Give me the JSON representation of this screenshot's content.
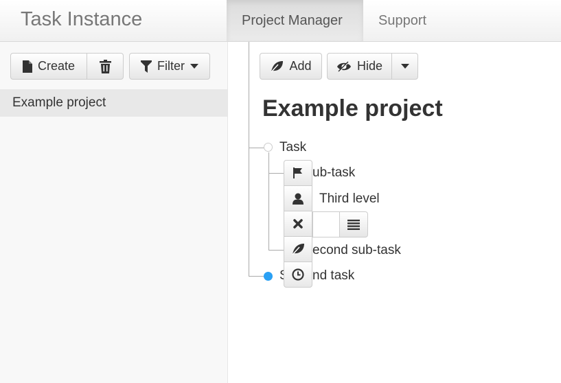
{
  "navbar": {
    "brand": "Task Instance",
    "tabs": [
      {
        "label": "Project Manager",
        "active": true
      },
      {
        "label": "Support",
        "active": false
      }
    ]
  },
  "sidebar": {
    "create_label": "Create",
    "filter_label": "Filter",
    "projects": [
      {
        "label": "Example project",
        "selected": true
      }
    ]
  },
  "main": {
    "add_label": "Add",
    "hide_label": "Hide",
    "title": "Example project",
    "tree": [
      {
        "label": "Task",
        "complete": false,
        "visible_text": "Task"
      },
      {
        "label": "Sub-task",
        "visible_text": "ub-task"
      },
      {
        "label": "Third level",
        "visible_text": "Third level"
      },
      {
        "label": "Second sub-task",
        "visible_text": "econd sub-task"
      },
      {
        "label": "Second task",
        "complete": true,
        "visible_text_start": "S",
        "visible_text_end": "nd task"
      }
    ],
    "node_tools": [
      "flag-icon",
      "user-icon",
      "remove-icon",
      "leaf-icon",
      "clock-icon"
    ]
  },
  "colors": {
    "accent_node": "#2aa0f4",
    "navbar_active_bg": "#e2e2e2",
    "sidebar_bg": "#f8f8f8",
    "selected_item_bg": "#e8e8e8"
  }
}
